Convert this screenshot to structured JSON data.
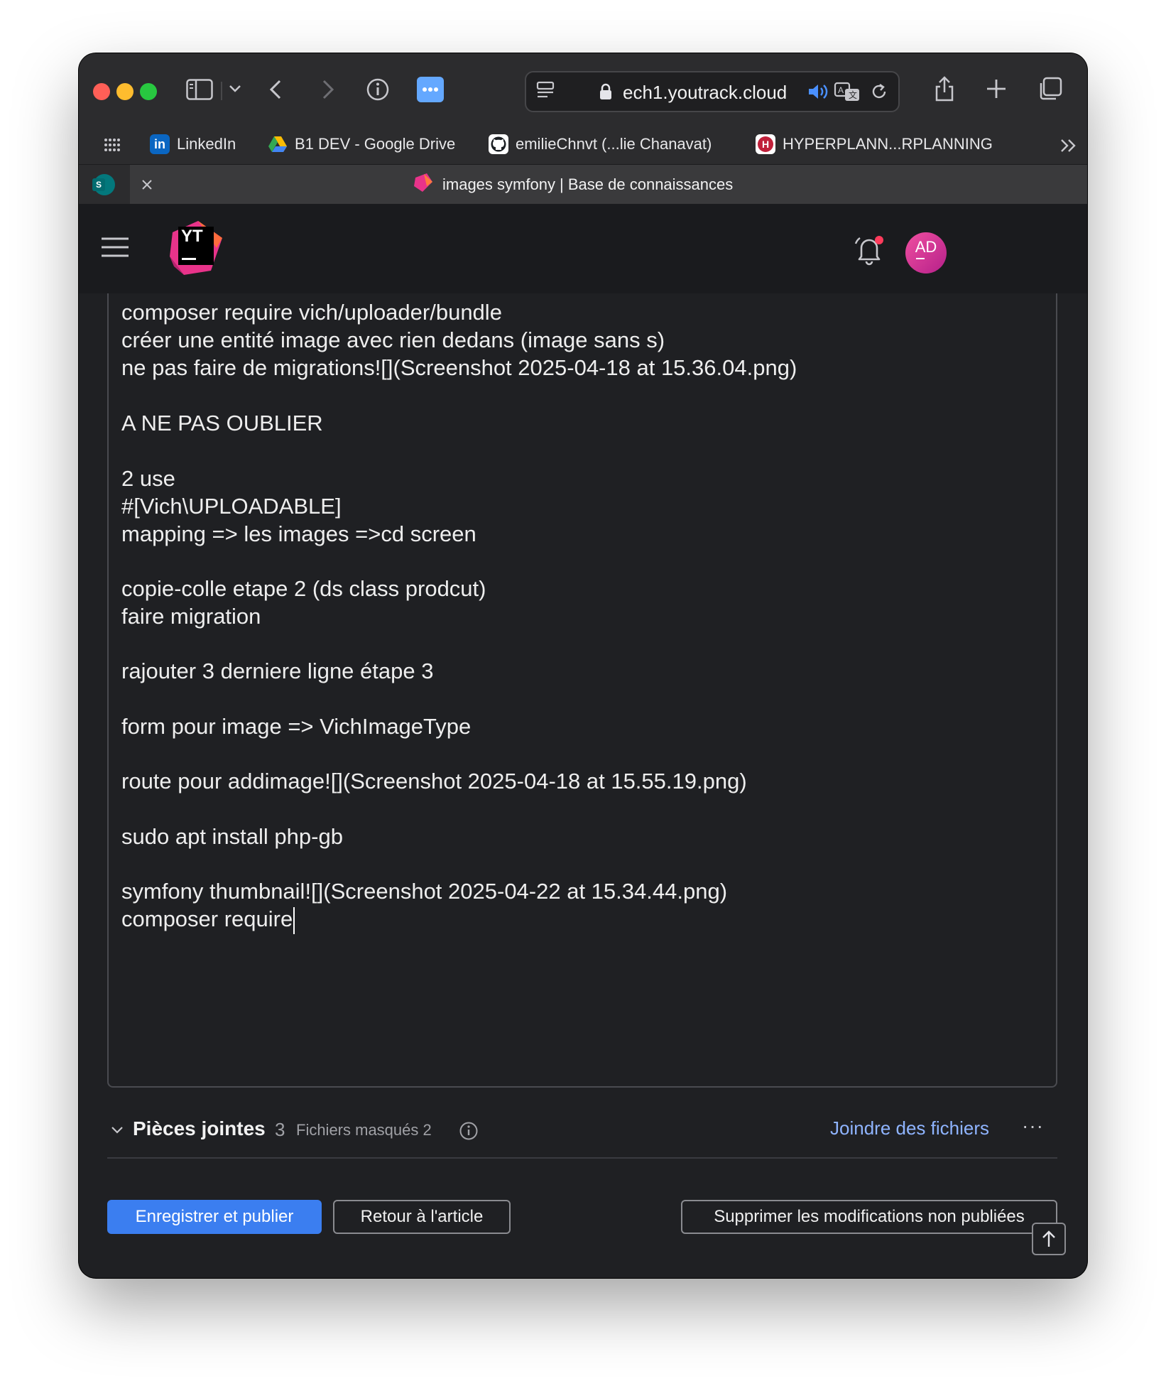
{
  "browser": {
    "url": "ech1.youtrack.cloud",
    "bookmarks": [
      {
        "label": "LinkedIn",
        "icon": "linkedin-icon"
      },
      {
        "label": "B1 DEV - Google Drive",
        "icon": "google-drive-icon"
      },
      {
        "label": "emilieChnvt (...lie Chanavat)",
        "icon": "github-icon"
      },
      {
        "label": "HYPERPLANN...RPLANNING",
        "icon": "hyperplanning-icon"
      }
    ],
    "pinned_tab_letter": "S",
    "active_tab_title": "images symfony | Base de connaissances"
  },
  "app": {
    "logo_text": "YT",
    "avatar_initials": "AD"
  },
  "editor": {
    "lines": [
      "composer require vich/uploader/bundle",
      "créer une entité image avec rien dedans (image sans s)",
      "ne pas faire de migrations![](Screenshot 2025-04-18 at 15.36.04.png)",
      "",
      "A NE PAS OUBLIER",
      "",
      "2 use",
      "#[Vich\\UPLOADABLE]",
      "mapping => les images =>cd screen",
      "",
      "copie-colle etape 2 (ds class prodcut)",
      "faire migration",
      "",
      "rajouter 3 derniere ligne étape 3",
      "",
      "form pour image => VichImageType",
      "",
      "route pour addimage![](Screenshot 2025-04-18 at 15.55.19.png)",
      "",
      "sudo apt install php-gb",
      "",
      "symfony thumbnail![](Screenshot 2025-04-22 at 15.34.44.png)",
      "composer require"
    ]
  },
  "attachments": {
    "title": "Pièces jointes",
    "count": "3",
    "hidden_label": "Fichiers masqués 2",
    "attach_link": "Joindre des fichiers",
    "more": "···"
  },
  "footer": {
    "save_publish": "Enregistrer et publier",
    "back_to_article": "Retour à l'article",
    "discard_changes": "Supprimer les modifications non publiées"
  },
  "colors": {
    "accent": "#3b7ef0",
    "link": "#8fb4ff",
    "notification_dot": "#ff3b5c",
    "avatar": "#d6338f"
  }
}
